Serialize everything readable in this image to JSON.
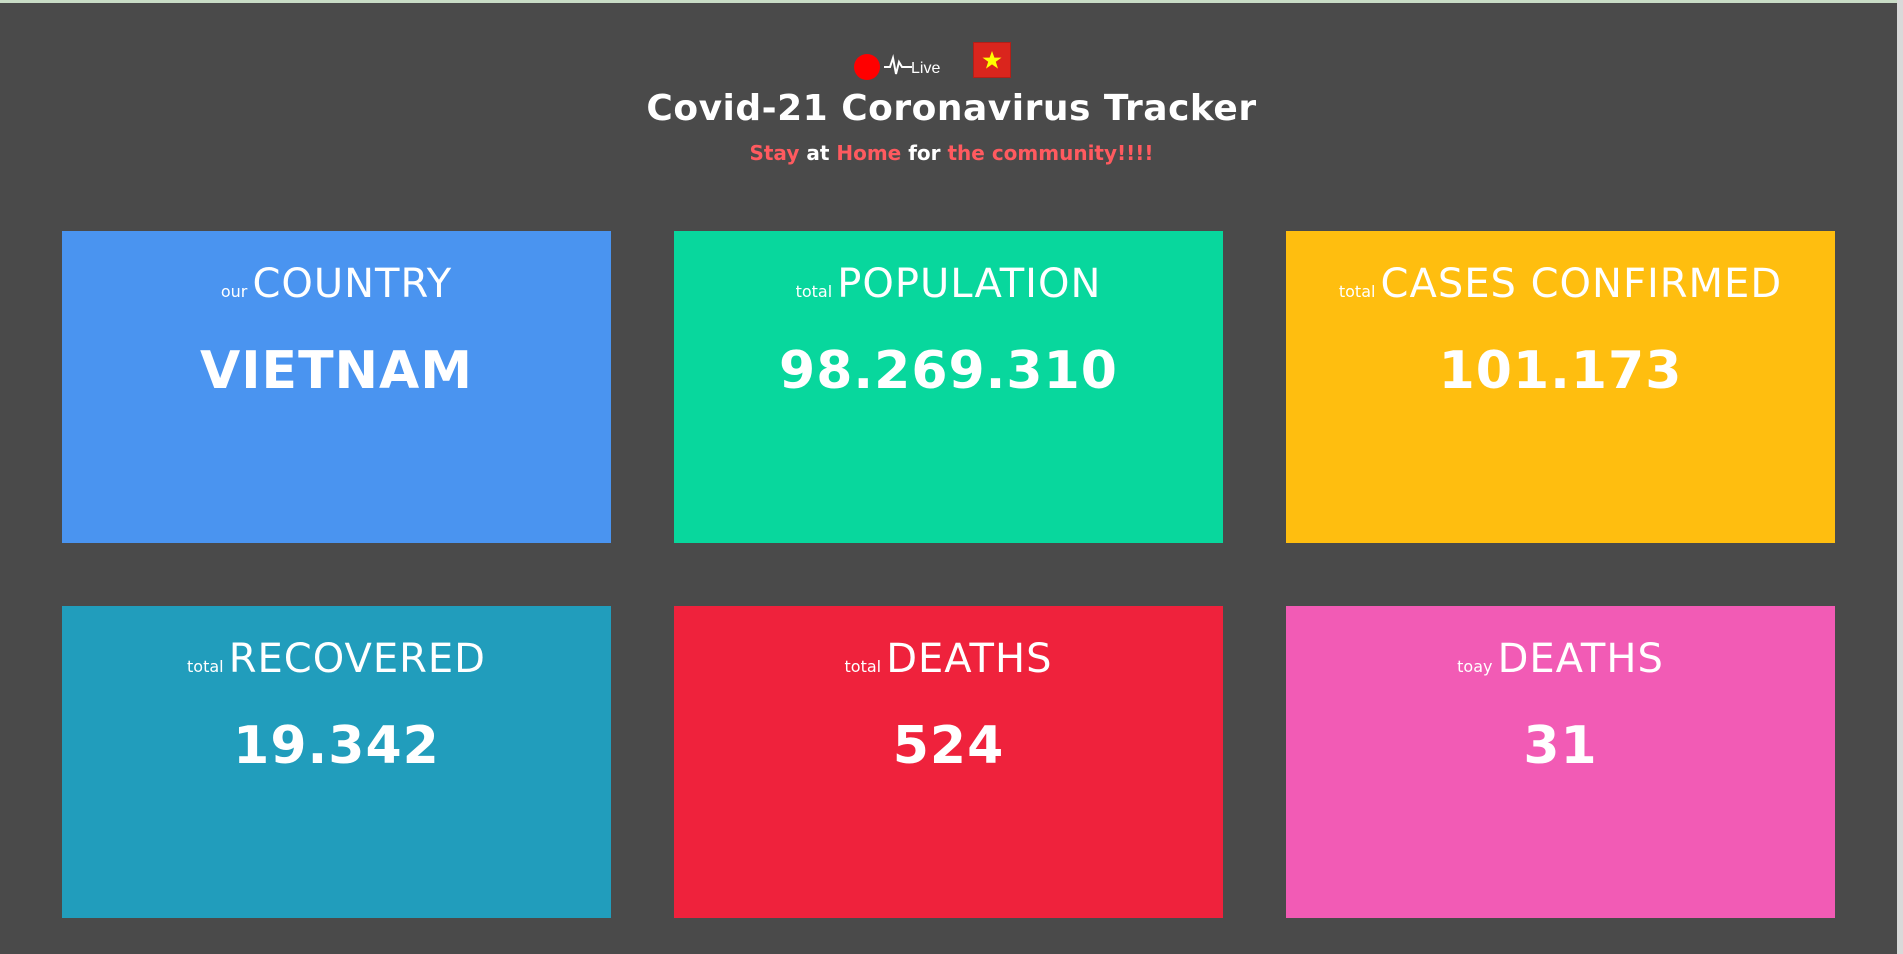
{
  "header": {
    "live_label": "Live",
    "title": "Covid-21 Coronavirus Tracker",
    "subtitle": {
      "stay": "Stay",
      "at": "at",
      "home": "Home",
      "for": "for",
      "community": "the community!!!!"
    },
    "flag_icon": "vietnam-flag-icon",
    "live_icon": "heartbeat-icon"
  },
  "colors": {
    "background": "#4a4a4a",
    "accent_red": "#ff5a5f",
    "country": "#4a94f0",
    "population": "#08d79d",
    "cases": "#ffbe0f",
    "recovered": "#219dbc",
    "deaths": "#ef223c",
    "today_deaths": "#f25bb5"
  },
  "cards": [
    {
      "small": "our",
      "big": "COUNTRY",
      "value": "VIETNAM"
    },
    {
      "small": "total",
      "big": "POPULATION",
      "value": "98.269.310"
    },
    {
      "small": "total",
      "big": "CASES CONFIRMED",
      "value": "101.173"
    },
    {
      "small": "total",
      "big": "RECOVERED",
      "value": "19.342"
    },
    {
      "small": "total",
      "big": "DEATHS",
      "value": "524"
    },
    {
      "small": "toay",
      "big": "DEATHS",
      "value": "31"
    }
  ]
}
